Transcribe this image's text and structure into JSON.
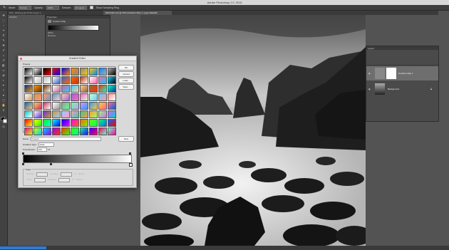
{
  "app": {
    "title": "Adobe Photoshop CC 2015"
  },
  "options_bar": {
    "mode_label": "Mode:",
    "mode_value": "Normal",
    "opacity_label": "Opacity:",
    "opacity_value": "100%",
    "sample_label": "Sample:",
    "sample_value": "All Layers",
    "checkbox_label": "Show Sampling Ring"
  },
  "tabs": [
    {
      "label": "DSC_5345.jpg @ 33.3% (Layer 1, RGB/8*)"
    },
    {
      "label": "DSC2422.psd @ 25% (Gradient Map 1, Layer Mask/8)"
    }
  ],
  "properties_panel": {
    "title": "Properties",
    "item_label": "Gradient Map",
    "option1": "Dither",
    "option2": "Reverse"
  },
  "gradient_editor": {
    "title": "Gradient Editor",
    "presets_label": "Presets",
    "buttons": {
      "ok": "OK",
      "cancel": "Cancel",
      "load": "Load...",
      "save": "Save...",
      "new": "New"
    },
    "name_label": "Name:",
    "name_value": "Custom",
    "type_label": "Gradient Type:",
    "type_value": "Solid",
    "smooth_label": "Smoothness:",
    "smooth_value": "100",
    "smooth_unit": "%",
    "stops_label": "Stops",
    "opacity_label": "Opacity:",
    "color_label": "Color:",
    "location_label": "Location:",
    "location_unit": "%",
    "delete_label": "Delete"
  },
  "layers_panel": {
    "title": "Layers",
    "layers": [
      {
        "name": "Gradient Map 1"
      },
      {
        "name": "Background"
      }
    ]
  },
  "preset_colors": [
    [
      "#000000",
      "#ffffff",
      "#000000",
      "#ff0000",
      "#0000ff",
      "#ff8800",
      "#888888",
      "#ffcc00",
      "#0088ff",
      "#aaaaaa"
    ],
    [
      "#000000",
      "#ffffff",
      "#c0c0c0",
      "#ffffff",
      "#3366cc",
      "#ff6600",
      "#cc3300",
      "#ffffff",
      "#ff66aa",
      "#00ccff"
    ],
    [
      "#003399",
      "#ff9900",
      "#663300",
      "#ffffff",
      "#cc6699",
      "#33ccff",
      "#ffcc99",
      "#996633",
      "#ff3300",
      "#00ffcc"
    ],
    [
      "#ffffff",
      "#cc9966",
      "#ff9966",
      "#6699cc",
      "#ffcccc",
      "#9966cc",
      "#ff66cc",
      "#ccffcc",
      "#66ccff",
      "#ff9999"
    ],
    [
      "#0066cc",
      "#ffcc66",
      "#cc3366",
      "#ffffff",
      "#999999",
      "#66ff99",
      "#cc99ff",
      "#3399ff",
      "#ffcc33",
      "#ff6699"
    ],
    [
      "#00cccc",
      "#ffffff",
      "#6633cc",
      "#cc9933",
      "#99ccff",
      "#ff99cc",
      "#33cc99",
      "#ff9933",
      "#99ff66",
      "#cc66ff"
    ],
    [
      "#ff0000",
      "#ffff00",
      "#00ff00",
      "#00ffff",
      "#0000ff",
      "#ff00ff",
      "#ff6600",
      "#66ff00",
      "#00ff66",
      "#0066ff"
    ],
    [
      "#ff0099",
      "#ccff00",
      "#00ccff",
      "#9900ff",
      "#ff3300",
      "#33ff00",
      "#00ff99",
      "#3300ff",
      "#ff0066",
      "#66ffcc"
    ]
  ]
}
